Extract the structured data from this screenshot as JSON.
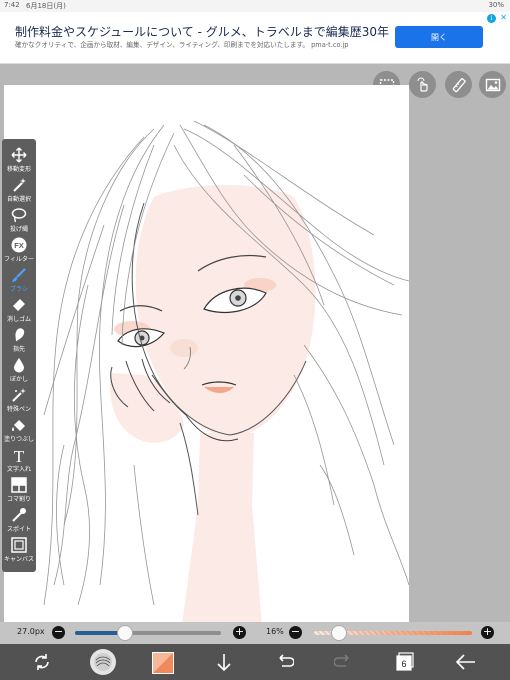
{
  "status_bar": {
    "time": "7:42",
    "date": "6月18日(月)",
    "battery": "30%"
  },
  "ad": {
    "title": "制作料金やスケジュールについて - グルメ、トラベルまで編集歴30年",
    "description": "確かなクオリティで、企画から取材、編集、デザイン、ライティング、印刷までを対応いたします。 pma-t.co.jp",
    "button_label": "開く",
    "info_label": "i",
    "close_label": "✕"
  },
  "top_tools": [
    {
      "icon": "selection-rect-icon"
    },
    {
      "icon": "hand-gesture-icon"
    },
    {
      "icon": "ruler-icon"
    },
    {
      "icon": "image-icon"
    }
  ],
  "toolbar": {
    "items": [
      {
        "label": "移動変形",
        "icon": "move-arrows-icon"
      },
      {
        "label": "自動選択",
        "icon": "magic-wand-icon"
      },
      {
        "label": "投げ縄",
        "icon": "lasso-icon"
      },
      {
        "label": "フィルター",
        "icon": "fx-icon",
        "glyph": "FX"
      },
      {
        "label": "ブラシ",
        "icon": "brush-icon",
        "active": true
      },
      {
        "label": "消しゴム",
        "icon": "eraser-icon"
      },
      {
        "label": "指先",
        "icon": "smudge-finger-icon"
      },
      {
        "label": "ぼかし",
        "icon": "blur-drop-icon"
      },
      {
        "label": "特殊ペン",
        "icon": "special-pen-icon"
      },
      {
        "label": "塗りつぶし",
        "icon": "fill-bucket-icon"
      },
      {
        "label": "文字入れ",
        "icon": "text-icon",
        "glyph": "T"
      },
      {
        "label": "コマ割り",
        "icon": "frame-divider-icon"
      },
      {
        "label": "スポイト",
        "icon": "eyedropper-icon"
      },
      {
        "label": "キャンバス",
        "icon": "canvas-icon"
      }
    ]
  },
  "brush": {
    "size_text": "27.0px",
    "size_level": 0.34,
    "opacity_text": "16%",
    "opacity_level": 0.16,
    "minus_label": "−",
    "plus_label": "+"
  },
  "bottom_bar": {
    "layer_count": "6",
    "items": [
      "transform-icon",
      "brush-preview-icon",
      "color-swatch-icon",
      "down-arrow-icon",
      "undo-icon",
      "redo-icon",
      "layers-icon",
      "back-arrow-icon"
    ]
  },
  "colors": {
    "accent_blue": "#1a73e8",
    "active_tool": "#4ea0ff",
    "size_slider": "#2b5f94",
    "opacity_slider": "#f0824b",
    "swatch": "#f08a5d"
  }
}
